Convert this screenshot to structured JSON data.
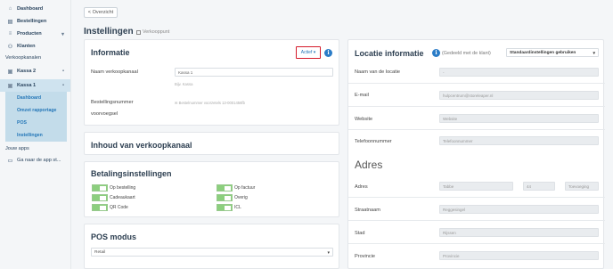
{
  "sidebar": {
    "dashboard": "Dashboard",
    "bestellingen": "Bestellingen",
    "producten": "Producten",
    "klanten": "Klanten",
    "section_verkoopkanalen": "Verkoopkanalen",
    "kassa2": "Kassa 2",
    "kassa1": "Kassa 1",
    "sub_items": [
      "Dashboard",
      "Omzet rapportage",
      "POS",
      "Instellingen"
    ],
    "section_apps": "Jouw apps",
    "app_store": "Ga naar de app st..."
  },
  "header": {
    "back_label": "< Overzicht",
    "title": "Instellingen",
    "subtitle": "Verkooppunt"
  },
  "informatie": {
    "title": "Informatie",
    "status_label": "Actief ▾",
    "name_label": "Naam verkoopkanaal",
    "name_value": "Kassa 1",
    "name_hint": "Bijv. Kassa",
    "order_label_1": "Bestellingsnummer",
    "order_label_2": "voorvoegsel",
    "order_hint": "✉ Bestelnummer voorzetels 13-0001456fb"
  },
  "inhoud": {
    "title": "Inhoud van verkoopkanaal"
  },
  "betaling": {
    "title": "Betalingsinstellingen",
    "options": [
      "Op bestelling",
      "Op factuur",
      "Cadeaukaart",
      "Overig",
      "QR Code",
      "ICL"
    ]
  },
  "pos": {
    "title": "POS modus",
    "value": "Retail"
  },
  "locatie": {
    "title": "Locatie informatie",
    "subtitle": "(Gedeeld met de klant)",
    "dropdown": "Standaardinstellingen gebruiken",
    "fields": [
      {
        "label": "Naam van de locatie",
        "value": "-"
      },
      {
        "label": "E-mail",
        "value": "hulpcentrum@storeleaper.nl"
      },
      {
        "label": "Website",
        "value": "Website"
      },
      {
        "label": "Telefoonnummer",
        "value": "Telefoonnummer"
      }
    ]
  },
  "adres": {
    "title": "Adres",
    "adres_label": "Adres",
    "street_value": "Tabbe",
    "number_value": "44",
    "addition_value": "Toevoeging",
    "straat_label": "Straatnaam",
    "straat_value": "Reggesingel",
    "stad_label": "Stad",
    "stad_value": "Rijssen",
    "provincie_label": "Provincie",
    "provincie_value": "Provincie"
  }
}
